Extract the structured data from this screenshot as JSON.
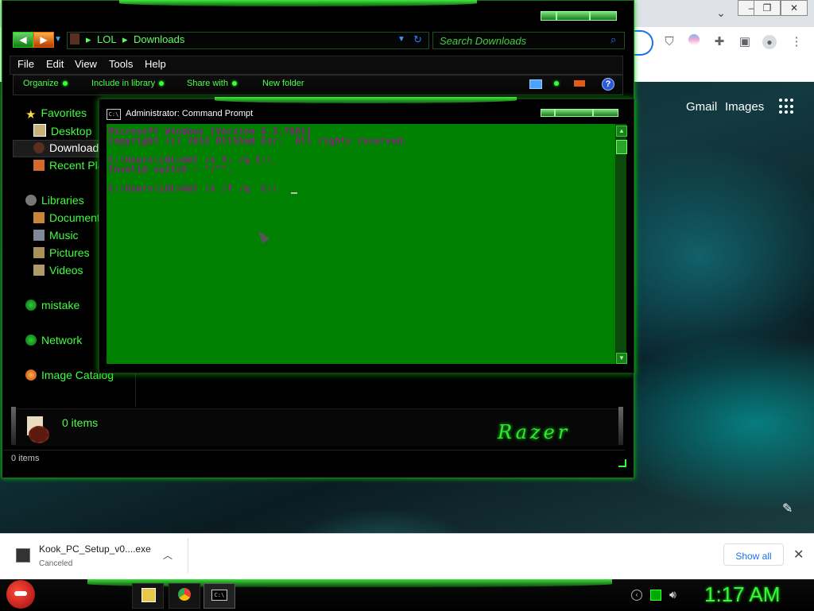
{
  "chrome": {
    "google_links": [
      "Gmail",
      "Images"
    ],
    "extension_icons": [
      "ublock-icon",
      "profile-color-icon",
      "puzzle-icon",
      "sidepanel-icon",
      "account-icon",
      "kebab-menu-icon"
    ]
  },
  "explorer": {
    "address": {
      "segments": [
        "LOL",
        "Downloads"
      ],
      "separator": "▸"
    },
    "search": {
      "placeholder": "Search Downloads"
    },
    "menu": [
      "File",
      "Edit",
      "View",
      "Tools",
      "Help"
    ],
    "command_bar": [
      "Organize",
      "Include in library",
      "Share with",
      "New folder"
    ],
    "nav": {
      "favorites": "Favorites",
      "desktop": "Desktop",
      "downloads": "Downloads",
      "recent_places": "Recent Pla",
      "libraries": "Libraries",
      "documents": "Document",
      "music": "Music",
      "pictures": "Pictures",
      "videos": "Videos",
      "homegroup": "mistake",
      "network": "Network",
      "image_catalog": "Image Catalog"
    },
    "details": {
      "items_count": "0 items",
      "brand": "Razer"
    },
    "status": "0 items"
  },
  "cmd": {
    "title": "Administrator: Command Prompt",
    "lines": [
      "Microsoft Windows [Version 6.3.7601]",
      "Copyright (c) 2012 DllShad Ezr.  All rights reserved.",
      "",
      "C:\\Users\\LOL>del /s f: /q C:\\",
      "Invalid switch - \"/^\".",
      "",
      "C:\\Users\\LOL>del /s /f /q  C:\\"
    ]
  },
  "download_shelf": {
    "file_name": "Kook_PC_Setup_v0....exe",
    "status": "Canceled",
    "show_all": "Show all"
  },
  "taskbar": {
    "clock": "1:17 AM",
    "cmd_glyph": "C:\\"
  },
  "colors": {
    "accent_green": "#3fff3f",
    "console_bg": "#008000",
    "console_text": "#8a1f82",
    "chrome_link_blue": "#1a73e8"
  }
}
